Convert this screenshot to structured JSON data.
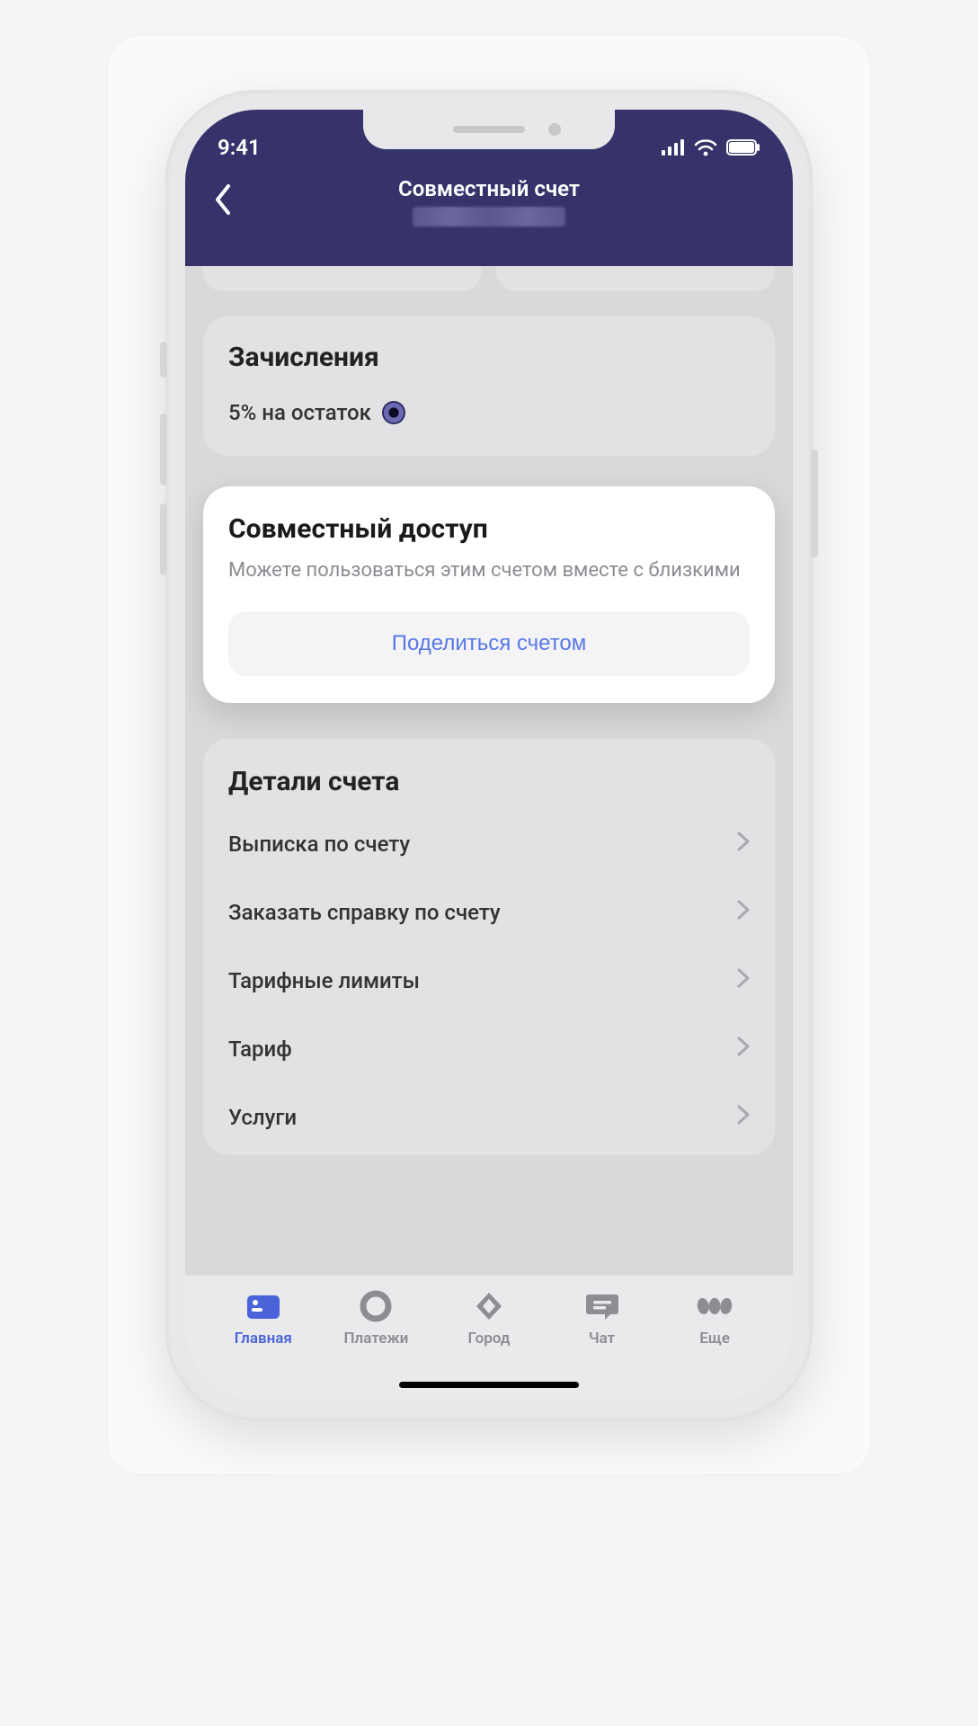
{
  "status": {
    "time": "9:41"
  },
  "nav": {
    "title": "Совместный счет"
  },
  "accruals": {
    "title": "Зачисления",
    "interest_text": "5% на остаток"
  },
  "shared": {
    "title": "Совместный доступ",
    "subtitle": "Можете пользоваться этим счетом вместе с близкими",
    "button": "Поделиться счетом"
  },
  "details": {
    "title": "Детали счета",
    "rows": [
      "Выписка по счету",
      "Заказать справку по счету",
      "Тарифные лимиты",
      "Тариф",
      "Услуги"
    ]
  },
  "tabs": [
    {
      "label": "Главная",
      "active": true
    },
    {
      "label": "Платежи",
      "active": false
    },
    {
      "label": "Город",
      "active": false
    },
    {
      "label": "Чат",
      "active": false
    },
    {
      "label": "Еще",
      "active": false
    }
  ]
}
